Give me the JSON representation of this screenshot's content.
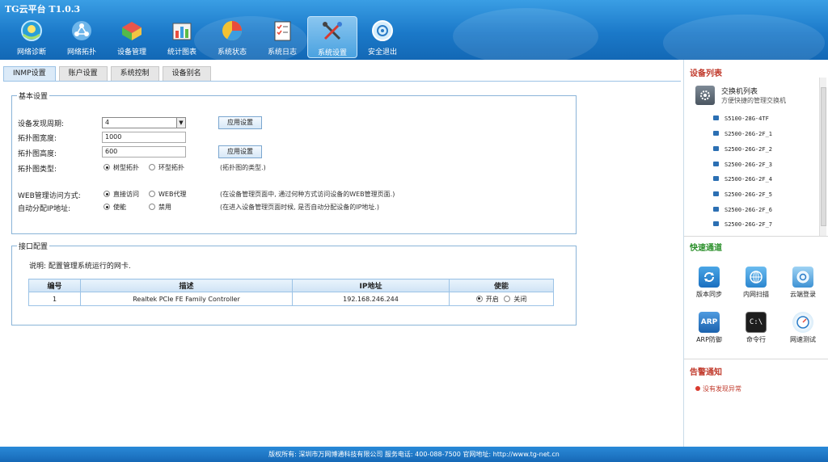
{
  "app_title": "TG云平台 T1.0.3",
  "nav": [
    {
      "label": "网络诊断",
      "icon": "globe-diagnosis-icon"
    },
    {
      "label": "网络拓扑",
      "icon": "topology-icon"
    },
    {
      "label": "设备管理",
      "icon": "device-cube-icon"
    },
    {
      "label": "统计图表",
      "icon": "statistics-chart-icon"
    },
    {
      "label": "系统状态",
      "icon": "pie-status-icon"
    },
    {
      "label": "系统日志",
      "icon": "log-checklist-icon"
    },
    {
      "label": "系统设置",
      "icon": "tools-settings-icon",
      "active": true
    },
    {
      "label": "安全退出",
      "icon": "power-exit-icon"
    }
  ],
  "tabs": [
    "INMP设置",
    "账户设置",
    "系统控制",
    "设备别名"
  ],
  "basic": {
    "legend": "基本设置",
    "discovery_label": "设备发现周期:",
    "discovery_value": "4",
    "apply1": "应用设置",
    "width_label": "拓扑图宽度:",
    "width_value": "1000",
    "height_label": "拓扑图高度:",
    "height_value": "600",
    "apply2": "应用设置",
    "type_label": "拓扑图类型:",
    "type_opt1": "树型拓扑",
    "type_opt2": "环型拓扑",
    "type_hint": "(拓扑图的类型.)",
    "web_label": "WEB管理访问方式:",
    "web_opt1": "直接访问",
    "web_opt2": "WEB代理",
    "web_hint": "(在设备管理页面中, 通过何种方式访问设备的WEB管理页面.)",
    "ip_label": "自动分配IP地址:",
    "ip_opt1": "使能",
    "ip_opt2": "禁用",
    "ip_hint": "(在进入设备管理页面时候, 是否自动分配设备的IP地址.)"
  },
  "iface": {
    "legend": "接口配置",
    "desc": "说明: 配置管理系统运行的网卡.",
    "headers": [
      "编号",
      "描述",
      "IP地址",
      "使能"
    ],
    "rows": [
      {
        "no": "1",
        "desc": "Realtek PCIe FE Family Controller",
        "ip": "192.168.246.244",
        "on": "开启",
        "off": "关闭"
      }
    ]
  },
  "sidebar": {
    "device_list_title": "设备列表",
    "switch_title": "交换机列表",
    "switch_sub": "方便快捷的管理交换机",
    "devices": [
      "S5100-28G-4TF",
      "S2500-26G-2F_1",
      "S2500-26G-2F_2",
      "S2500-26G-2F_3",
      "S2500-26G-2F_4",
      "S2500-26G-2F_5",
      "S2500-26G-2F_6",
      "S2500-26G-2F_7"
    ],
    "quick_title": "快速通道",
    "quick": [
      {
        "label": "版本同步",
        "icon": "sync-icon"
      },
      {
        "label": "内网扫描",
        "icon": "network-scan-icon"
      },
      {
        "label": "云端登录",
        "icon": "cloud-login-icon"
      },
      {
        "label": "ARP防御",
        "icon": "arp-defense-icon"
      },
      {
        "label": "命令行",
        "icon": "command-line-icon"
      },
      {
        "label": "网速测试",
        "icon": "speed-test-icon"
      }
    ],
    "alert_title": "告警通知",
    "alert_text": "没有发现异常"
  },
  "footer": "版权所有: 深圳市万网博通科技有限公司 服务电话: 400-088-7500 官网地址: http://www.tg-net.cn"
}
